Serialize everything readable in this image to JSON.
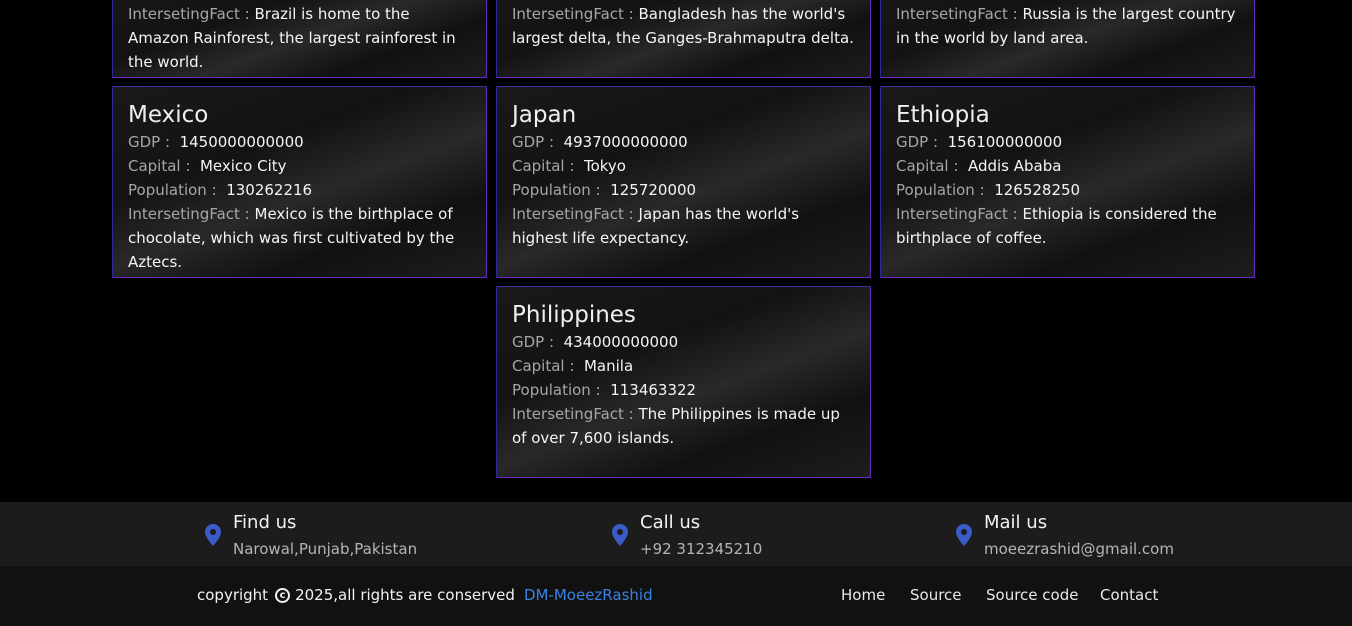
{
  "labels": {
    "gdp": "GDP :",
    "capital": "Capital :",
    "population": "Population :",
    "fact": "IntersetingFact :"
  },
  "cards_top": [
    {
      "fact": "Brazil is home to the Amazon Rainforest, the largest rainforest in the world."
    },
    {
      "fact": "Bangladesh has the world's largest delta, the Ganges-Brahmaputra delta."
    },
    {
      "fact": "Russia is the largest country in the world by land area."
    }
  ],
  "cards": [
    {
      "name": "Mexico",
      "gdp": "1450000000000",
      "capital": "Mexico City",
      "population": "130262216",
      "fact": "Mexico is the birthplace of chocolate, which was first cultivated by the Aztecs."
    },
    {
      "name": "Japan",
      "gdp": "4937000000000",
      "capital": "Tokyo",
      "population": "125720000",
      "fact": "Japan has the world's highest life expectancy."
    },
    {
      "name": "Ethiopia",
      "gdp": "156100000000",
      "capital": "Addis Ababa",
      "population": "126528250",
      "fact": "Ethiopia is considered the birthplace of coffee."
    },
    {
      "name": "Philippines",
      "gdp": "434000000000",
      "capital": "Manila",
      "population": "113463322",
      "fact": "The Philippines is made up of over 7,600 islands."
    }
  ],
  "contacts": [
    {
      "title": "Find us",
      "sub": "Narowal,Punjab,Pakistan",
      "icon": "location-pin-icon"
    },
    {
      "title": "Call us",
      "sub": "+92 312345210",
      "icon": "location-pin-icon"
    },
    {
      "title": "Mail us",
      "sub": "moeezrashid@gmail.com",
      "icon": "location-pin-icon"
    }
  ],
  "footer": {
    "copyright_pre": "copyright",
    "copyright_symbol": "c",
    "copyright_post": "2025,all rights are conserved",
    "author_link": "DM-MoeezRashid",
    "nav": [
      "Home",
      "Source",
      "Source code",
      "Contact"
    ]
  },
  "colors": {
    "accent": "#3b82e6",
    "pin": "#3b5bc8",
    "card_border": "#6b2bb8"
  }
}
